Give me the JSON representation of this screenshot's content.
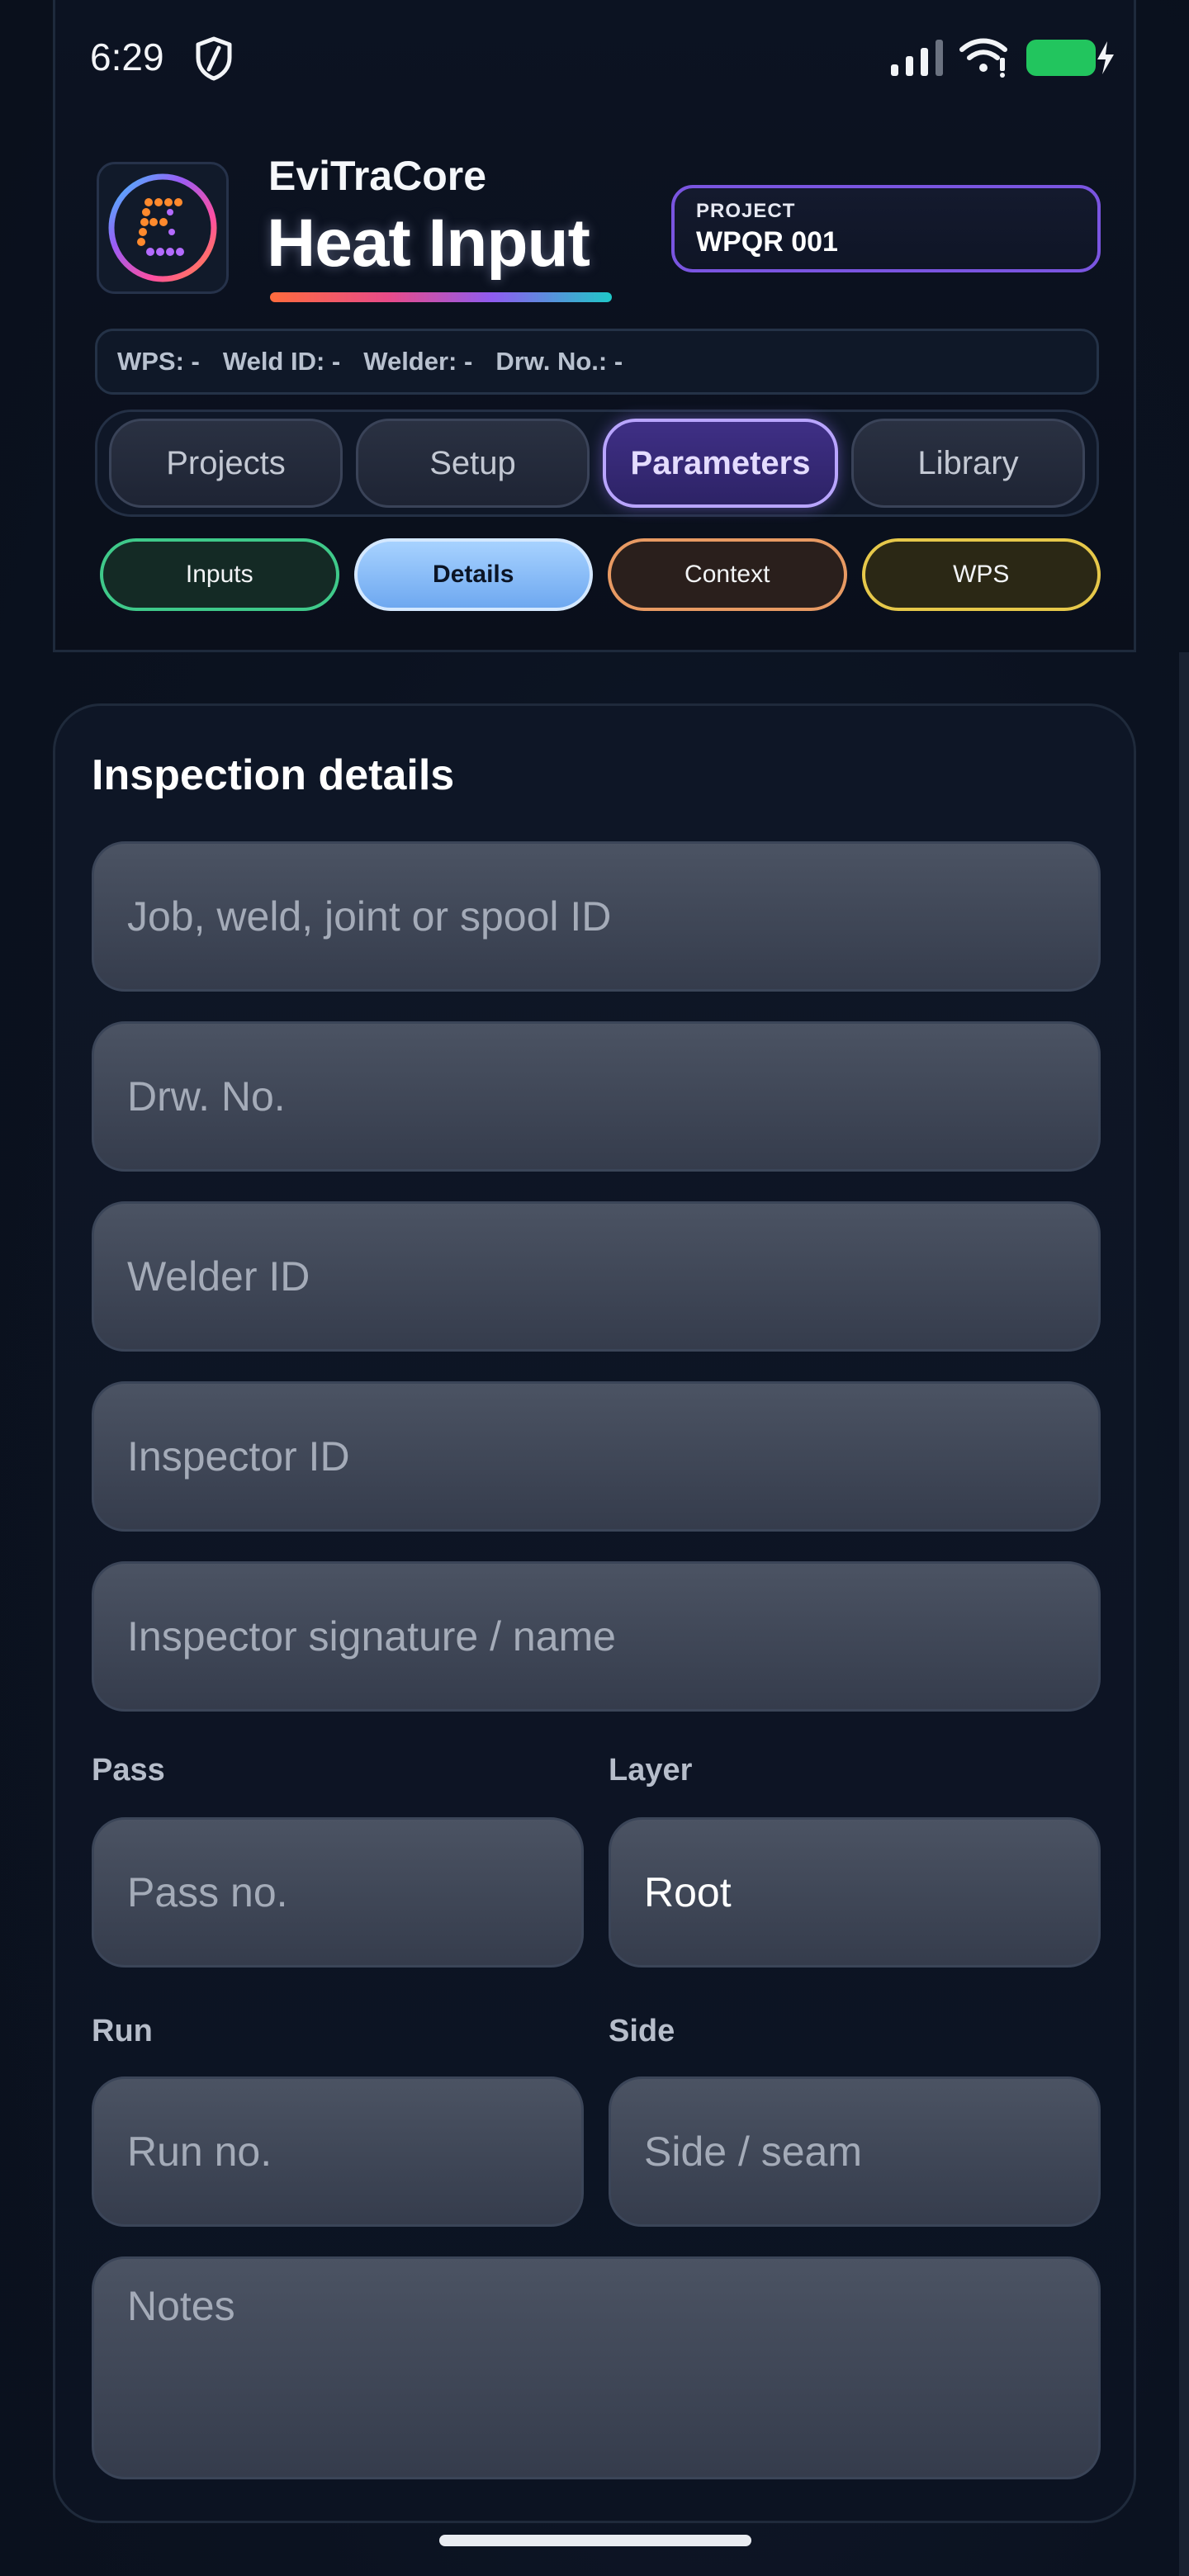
{
  "status_bar": {
    "time": "6:29",
    "icons": [
      "shield-icon",
      "signal-icon",
      "wifi-icon",
      "battery-charging-icon"
    ],
    "battery_color": "#22c55e"
  },
  "header": {
    "app_name": "EviTraCore",
    "title": "Heat Input",
    "project": {
      "label": "PROJECT",
      "value": "WPQR 001"
    },
    "meta": {
      "wps": "WPS: -",
      "weld_id": "Weld ID: -",
      "welder": "Welder: -",
      "drw_no": "Drw. No.: -"
    }
  },
  "main_tabs": [
    {
      "label": "Projects",
      "active": false
    },
    {
      "label": "Setup",
      "active": false
    },
    {
      "label": "Parameters",
      "active": true
    },
    {
      "label": "Library",
      "active": false
    }
  ],
  "sub_tabs": [
    {
      "label": "Inputs",
      "color": "#3fc98a"
    },
    {
      "label": "Details",
      "color": "#a7d2ff",
      "active": true
    },
    {
      "label": "Context",
      "color": "#e89a63"
    },
    {
      "label": "WPS",
      "color": "#e6c84a"
    }
  ],
  "inspection": {
    "title": "Inspection details",
    "job_placeholder": "Job, weld, joint or spool ID",
    "drw_placeholder": "Drw. No.",
    "welder_placeholder": "Welder ID",
    "inspector_placeholder": "Inspector ID",
    "signature_placeholder": "Inspector signature / name",
    "pass_label": "Pass",
    "pass_placeholder": "Pass no.",
    "layer_label": "Layer",
    "layer_value": "Root",
    "run_label": "Run",
    "run_placeholder": "Run no.",
    "side_label": "Side",
    "side_placeholder": "Side / seam",
    "notes_placeholder": "Notes"
  }
}
